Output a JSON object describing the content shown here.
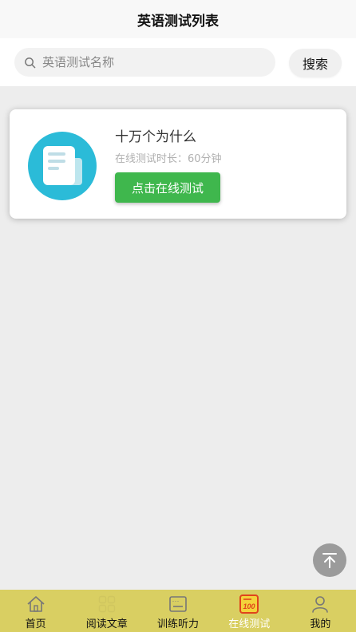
{
  "header": {
    "title": "英语测试列表"
  },
  "search": {
    "placeholder": "英语测试名称",
    "button_label": "搜索"
  },
  "tests": [
    {
      "title": "十万个为什么",
      "duration_label": "在线测试时长：60分钟",
      "action_label": "点击在线测试"
    }
  ],
  "back_to_top": {
    "icon": "arrow-up-to-top-icon"
  },
  "tabbar": {
    "items": [
      {
        "label": "首页",
        "icon": "home-icon"
      },
      {
        "label": "阅读文章",
        "icon": "grid-icon"
      },
      {
        "label": "训练听力",
        "icon": "headset-icon"
      },
      {
        "label": "在线测试",
        "icon": "test-paper-icon"
      },
      {
        "label": "我的",
        "icon": "user-icon"
      }
    ],
    "active_index": 3
  },
  "colors": {
    "accent_green": "#3fb74d",
    "tabbar_bg": "#d9cf62",
    "icon_circle": "#2bbbd8",
    "active_tab_icon": "#e0441b"
  }
}
